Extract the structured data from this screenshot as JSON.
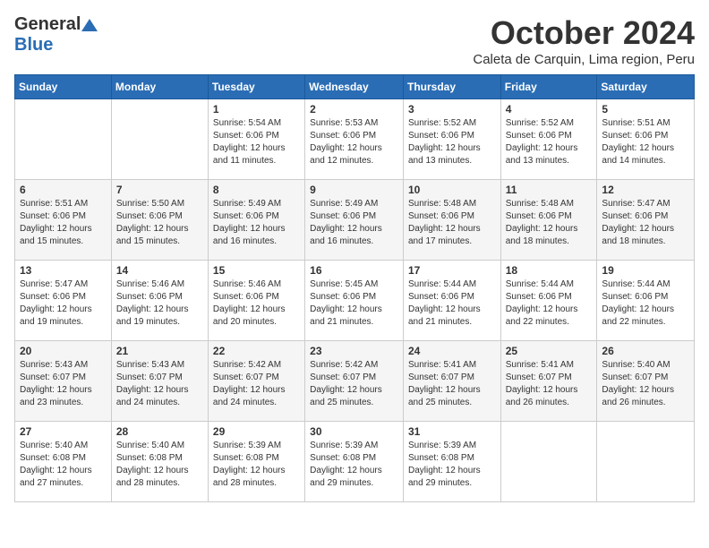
{
  "logo": {
    "general": "General",
    "blue": "Blue"
  },
  "title": "October 2024",
  "location": "Caleta de Carquin, Lima region, Peru",
  "days_header": [
    "Sunday",
    "Monday",
    "Tuesday",
    "Wednesday",
    "Thursday",
    "Friday",
    "Saturday"
  ],
  "weeks": [
    [
      {
        "day": "",
        "info": ""
      },
      {
        "day": "",
        "info": ""
      },
      {
        "day": "1",
        "info": "Sunrise: 5:54 AM\nSunset: 6:06 PM\nDaylight: 12 hours and 11 minutes."
      },
      {
        "day": "2",
        "info": "Sunrise: 5:53 AM\nSunset: 6:06 PM\nDaylight: 12 hours and 12 minutes."
      },
      {
        "day": "3",
        "info": "Sunrise: 5:52 AM\nSunset: 6:06 PM\nDaylight: 12 hours and 13 minutes."
      },
      {
        "day": "4",
        "info": "Sunrise: 5:52 AM\nSunset: 6:06 PM\nDaylight: 12 hours and 13 minutes."
      },
      {
        "day": "5",
        "info": "Sunrise: 5:51 AM\nSunset: 6:06 PM\nDaylight: 12 hours and 14 minutes."
      }
    ],
    [
      {
        "day": "6",
        "info": "Sunrise: 5:51 AM\nSunset: 6:06 PM\nDaylight: 12 hours and 15 minutes."
      },
      {
        "day": "7",
        "info": "Sunrise: 5:50 AM\nSunset: 6:06 PM\nDaylight: 12 hours and 15 minutes."
      },
      {
        "day": "8",
        "info": "Sunrise: 5:49 AM\nSunset: 6:06 PM\nDaylight: 12 hours and 16 minutes."
      },
      {
        "day": "9",
        "info": "Sunrise: 5:49 AM\nSunset: 6:06 PM\nDaylight: 12 hours and 16 minutes."
      },
      {
        "day": "10",
        "info": "Sunrise: 5:48 AM\nSunset: 6:06 PM\nDaylight: 12 hours and 17 minutes."
      },
      {
        "day": "11",
        "info": "Sunrise: 5:48 AM\nSunset: 6:06 PM\nDaylight: 12 hours and 18 minutes."
      },
      {
        "day": "12",
        "info": "Sunrise: 5:47 AM\nSunset: 6:06 PM\nDaylight: 12 hours and 18 minutes."
      }
    ],
    [
      {
        "day": "13",
        "info": "Sunrise: 5:47 AM\nSunset: 6:06 PM\nDaylight: 12 hours and 19 minutes."
      },
      {
        "day": "14",
        "info": "Sunrise: 5:46 AM\nSunset: 6:06 PM\nDaylight: 12 hours and 19 minutes."
      },
      {
        "day": "15",
        "info": "Sunrise: 5:46 AM\nSunset: 6:06 PM\nDaylight: 12 hours and 20 minutes."
      },
      {
        "day": "16",
        "info": "Sunrise: 5:45 AM\nSunset: 6:06 PM\nDaylight: 12 hours and 21 minutes."
      },
      {
        "day": "17",
        "info": "Sunrise: 5:44 AM\nSunset: 6:06 PM\nDaylight: 12 hours and 21 minutes."
      },
      {
        "day": "18",
        "info": "Sunrise: 5:44 AM\nSunset: 6:06 PM\nDaylight: 12 hours and 22 minutes."
      },
      {
        "day": "19",
        "info": "Sunrise: 5:44 AM\nSunset: 6:06 PM\nDaylight: 12 hours and 22 minutes."
      }
    ],
    [
      {
        "day": "20",
        "info": "Sunrise: 5:43 AM\nSunset: 6:07 PM\nDaylight: 12 hours and 23 minutes."
      },
      {
        "day": "21",
        "info": "Sunrise: 5:43 AM\nSunset: 6:07 PM\nDaylight: 12 hours and 24 minutes."
      },
      {
        "day": "22",
        "info": "Sunrise: 5:42 AM\nSunset: 6:07 PM\nDaylight: 12 hours and 24 minutes."
      },
      {
        "day": "23",
        "info": "Sunrise: 5:42 AM\nSunset: 6:07 PM\nDaylight: 12 hours and 25 minutes."
      },
      {
        "day": "24",
        "info": "Sunrise: 5:41 AM\nSunset: 6:07 PM\nDaylight: 12 hours and 25 minutes."
      },
      {
        "day": "25",
        "info": "Sunrise: 5:41 AM\nSunset: 6:07 PM\nDaylight: 12 hours and 26 minutes."
      },
      {
        "day": "26",
        "info": "Sunrise: 5:40 AM\nSunset: 6:07 PM\nDaylight: 12 hours and 26 minutes."
      }
    ],
    [
      {
        "day": "27",
        "info": "Sunrise: 5:40 AM\nSunset: 6:08 PM\nDaylight: 12 hours and 27 minutes."
      },
      {
        "day": "28",
        "info": "Sunrise: 5:40 AM\nSunset: 6:08 PM\nDaylight: 12 hours and 28 minutes."
      },
      {
        "day": "29",
        "info": "Sunrise: 5:39 AM\nSunset: 6:08 PM\nDaylight: 12 hours and 28 minutes."
      },
      {
        "day": "30",
        "info": "Sunrise: 5:39 AM\nSunset: 6:08 PM\nDaylight: 12 hours and 29 minutes."
      },
      {
        "day": "31",
        "info": "Sunrise: 5:39 AM\nSunset: 6:08 PM\nDaylight: 12 hours and 29 minutes."
      },
      {
        "day": "",
        "info": ""
      },
      {
        "day": "",
        "info": ""
      }
    ]
  ]
}
